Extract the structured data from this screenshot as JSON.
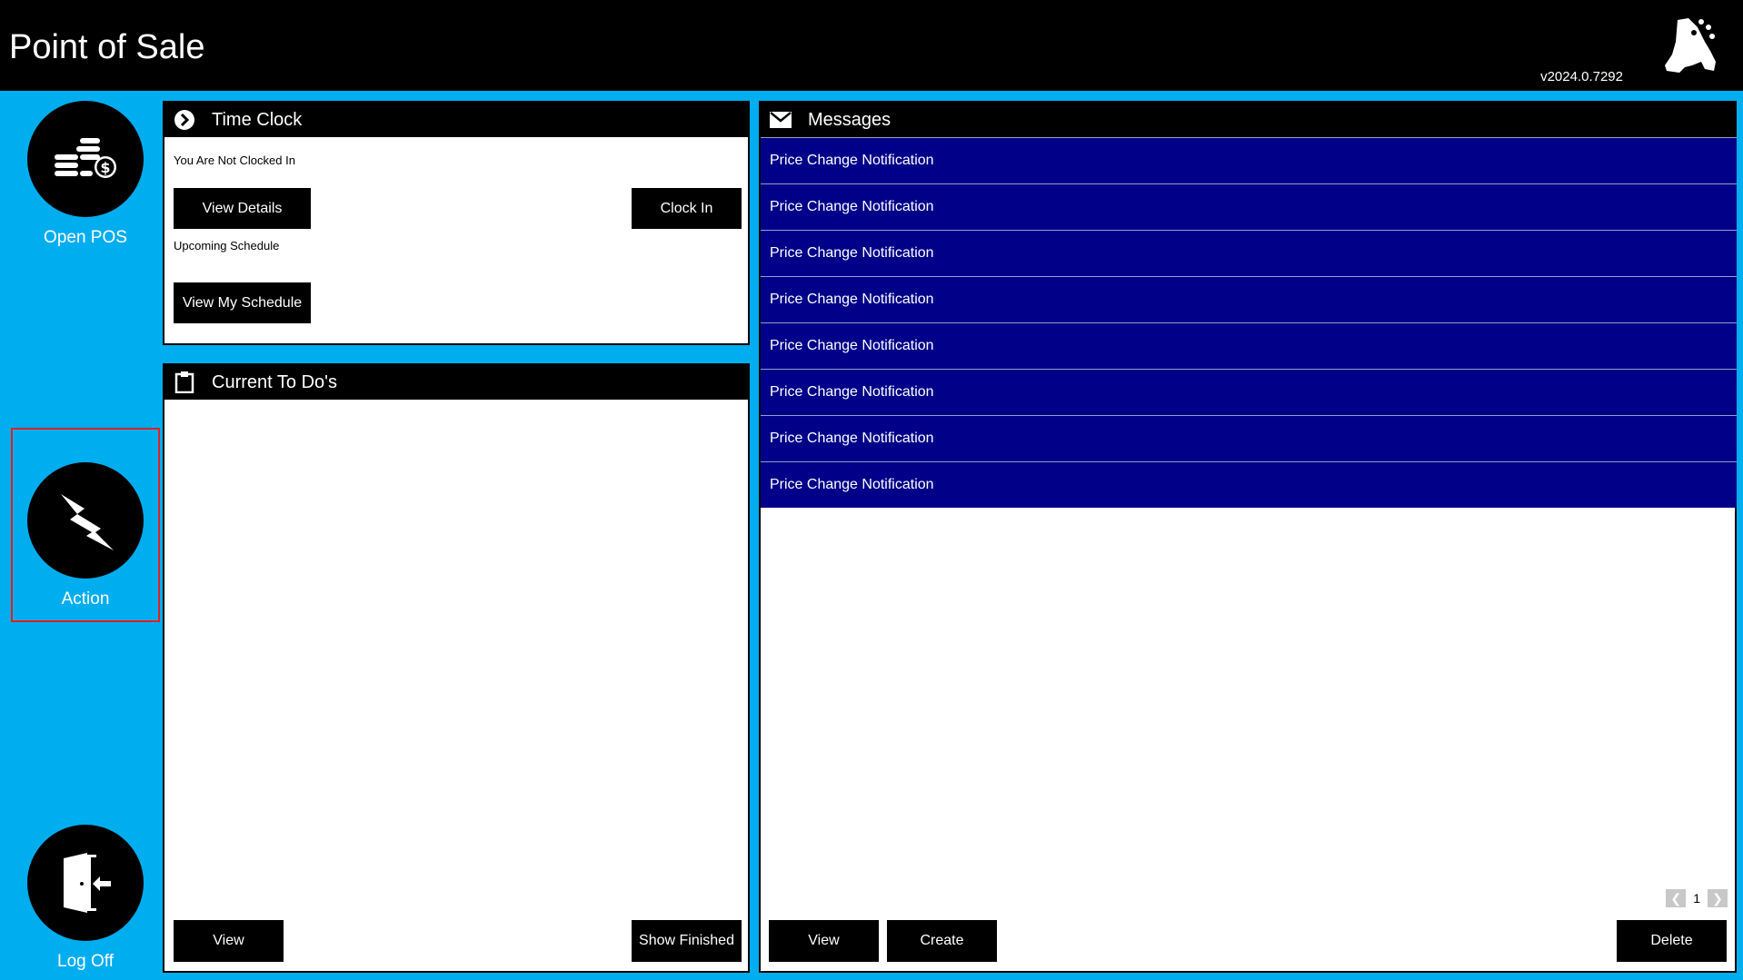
{
  "header": {
    "title": "Point of Sale",
    "version": "v2024.0.7292",
    "logo_icon": "robot-logo-icon"
  },
  "sidebar": {
    "items": [
      {
        "label": "Open POS",
        "icon": "coins-stack-icon"
      },
      {
        "label": "Action",
        "icon": "lightning-bolt-icon",
        "selected": true
      },
      {
        "label": "Log Off",
        "icon": "door-exit-icon"
      }
    ]
  },
  "time_clock": {
    "title": "Time Clock",
    "icon": "chevron-circle-icon",
    "status_text": "You Are Not Clocked In",
    "view_details_label": "View Details",
    "clock_in_label": "Clock In",
    "upcoming_label": "Upcoming Schedule",
    "view_schedule_label": "View My Schedule"
  },
  "todos": {
    "title": "Current To Do's",
    "icon": "clipboard-icon",
    "view_label": "View",
    "show_finished_label": "Show Finished"
  },
  "messages": {
    "title": "Messages",
    "icon": "envelope-icon",
    "items": [
      "Price Change Notification",
      "Price Change Notification",
      "Price Change Notification",
      "Price Change Notification",
      "Price Change Notification",
      "Price Change Notification",
      "Price Change Notification",
      "Price Change Notification"
    ],
    "page": "1",
    "view_label": "View",
    "create_label": "Create",
    "delete_label": "Delete"
  },
  "colors": {
    "background": "#00adef",
    "header": "#000000",
    "message_row": "#000089",
    "selection_outline": "#e02020"
  }
}
